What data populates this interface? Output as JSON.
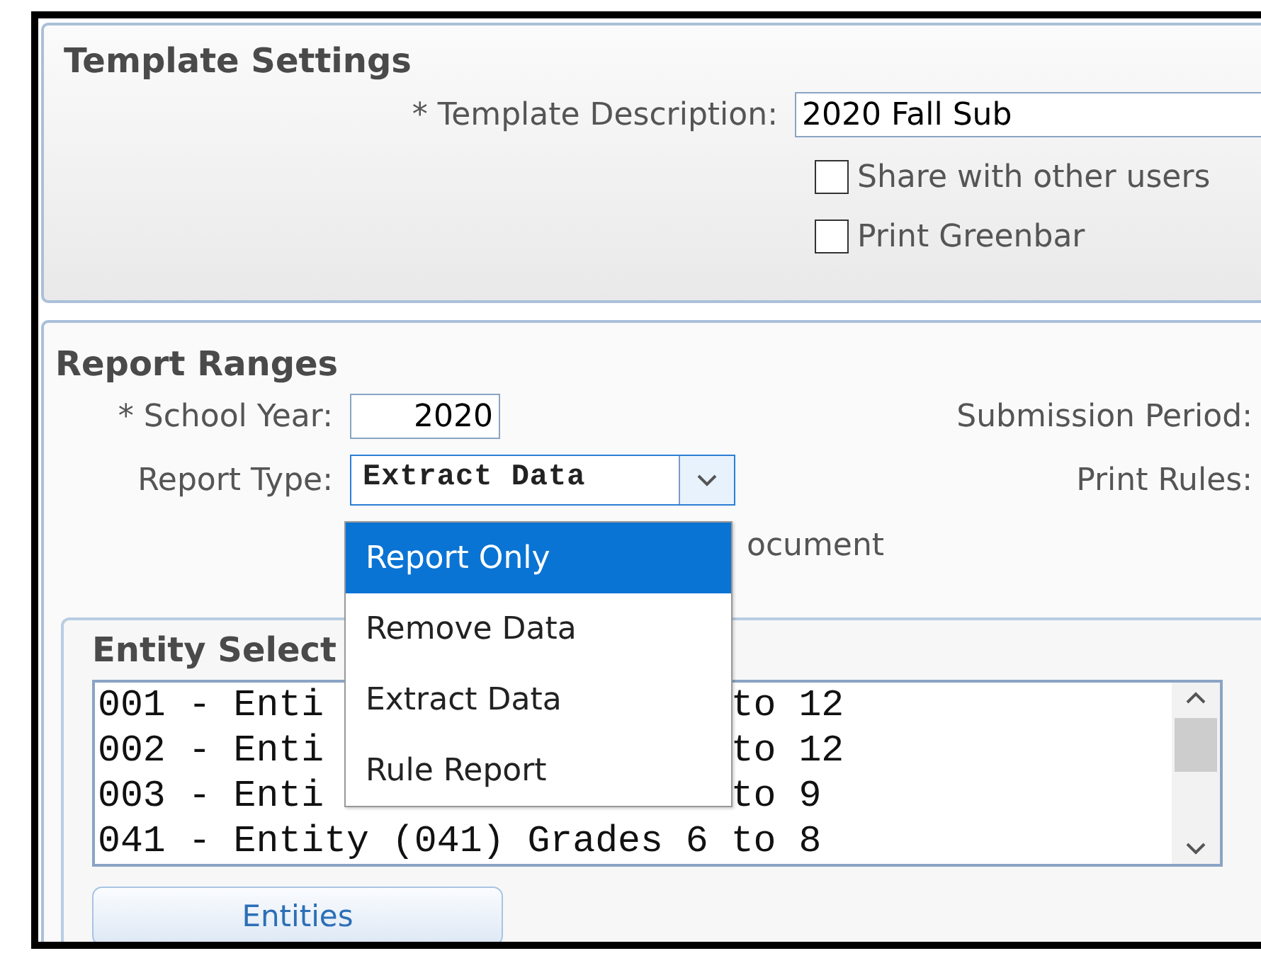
{
  "template_settings": {
    "title": "Template Settings",
    "description_label": "* Template Description:",
    "description_value": "2020 Fall Sub",
    "options": [
      {
        "label": "Share with other users",
        "checked": false
      },
      {
        "label": "Print Greenbar",
        "checked": false
      }
    ]
  },
  "report_ranges": {
    "title": "Report Ranges",
    "school_year_label": "* School Year:",
    "school_year_value": "2020",
    "submission_period_label": "Submission Period:",
    "report_type_label": "Report Type:",
    "report_type_value": "Extract Data",
    "print_rules_label": "Print Rules:",
    "partial_text": "ocument",
    "dropdown": {
      "expanded": true,
      "options": [
        {
          "label": "Report Only",
          "selected": true
        },
        {
          "label": "Remove Data",
          "selected": false
        },
        {
          "label": "Extract Data",
          "selected": false
        },
        {
          "label": "Rule Report",
          "selected": false
        }
      ]
    },
    "entity_selection": {
      "title": "Entity Select",
      "rows": [
        {
          "text": "001 - Enti",
          "tail": "to 12"
        },
        {
          "text": "002 - Enti",
          "tail": "to 12"
        },
        {
          "text": "003 - Enti",
          "tail": "to 9"
        },
        {
          "text": "041 - Entity (041) Grades 6 to 8"
        }
      ],
      "button": "Entities"
    }
  }
}
